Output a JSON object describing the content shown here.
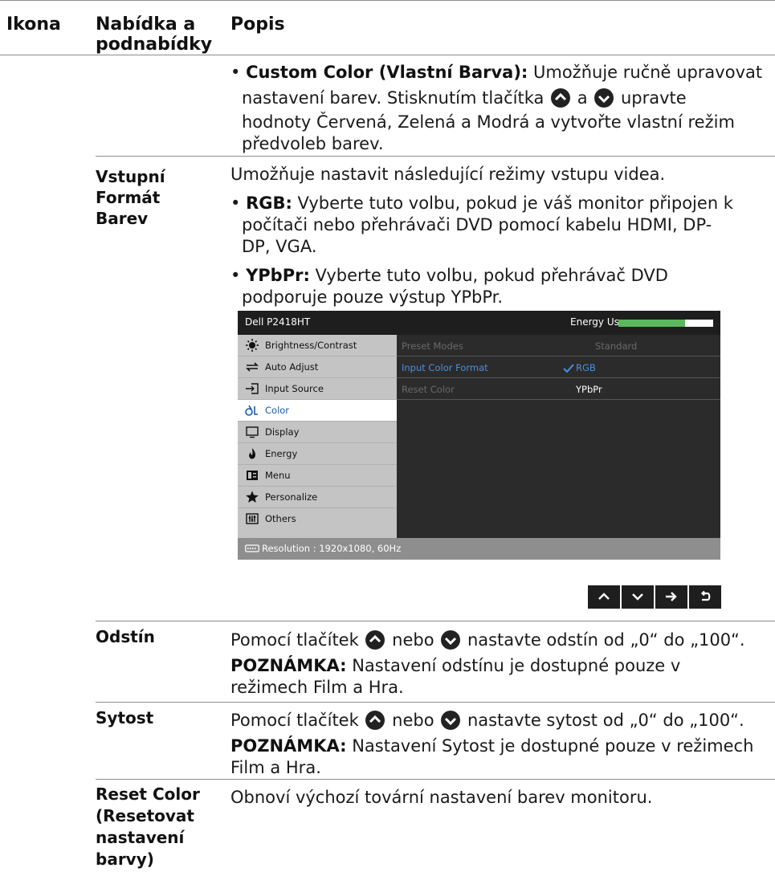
{
  "header": {
    "col1": "Ikona",
    "col2_line1": "Nabídka a",
    "col2_line2": "podnabídky",
    "col3": "Popis"
  },
  "custom_color": {
    "label": "Custom Color (Vlastní Barva):",
    "line1_rest": " Umožňuje ručně upravovat",
    "line2_a": "nastavení barev. Stisknutím tlačítka",
    "line2_b": "a",
    "line2_c": "upravte",
    "line3": "hodnoty Červená, Zelená a Modrá a vytvořte vlastní režim",
    "line4": "předvoleb barev."
  },
  "vstupni": {
    "menu_line1": "Vstupní",
    "menu_line2": "Formát",
    "menu_line3": "Barev",
    "intro": "Umožňuje nastavit následující režimy vstupu videa.",
    "rgb_label": "RGB:",
    "rgb_line1_rest": " Vyberte tuto volbu, pokud je váš monitor připojen k",
    "rgb_line2": "počítači nebo přehrávači DVD pomocí kabelu HDMI, DP-",
    "rgb_line3": "DP, VGA.",
    "ypbpr_label": "YPbPr:",
    "ypbpr_line1_rest": " Vyberte tuto volbu, pokud přehrávač DVD",
    "ypbpr_line2": "podporuje pouze výstup YPbPr."
  },
  "osd": {
    "title": "Dell  P2418HT",
    "energy_label": "Energy Use",
    "energy_level": 0.7,
    "menu": [
      {
        "label": "Brightness/Contrast",
        "icon": "brightness-icon"
      },
      {
        "label": "Auto Adjust",
        "icon": "auto-adjust-icon"
      },
      {
        "label": "Input Source",
        "icon": "input-source-icon"
      },
      {
        "label": "Color",
        "icon": "color-icon",
        "active": true
      },
      {
        "label": "Display",
        "icon": "display-icon"
      },
      {
        "label": "Energy",
        "icon": "energy-icon"
      },
      {
        "label": "Menu",
        "icon": "menu-icon"
      },
      {
        "label": "Personalize",
        "icon": "star-icon"
      },
      {
        "label": "Others",
        "icon": "others-icon"
      }
    ],
    "rows": [
      {
        "label": "Preset Modes",
        "value": "Standard"
      },
      {
        "label": "Input Color Format",
        "value": "RGB"
      },
      {
        "label": "Reset Color",
        "value": "YPbPr"
      }
    ],
    "resolution": "Resolution : 1920x1080, 60Hz",
    "colors": {
      "accent_blue": "#1b5aa6",
      "energy_green": "#5cb85c"
    }
  },
  "odstin": {
    "menu": "Odstín",
    "l1_a": "Pomocí tlačítek",
    "l1_b": "nebo",
    "l1_c": "nastavte odstín od „0“ do „100“.",
    "note_label": "POZNÁMKA:",
    "note_rest": " Nastavení odstínu je dostupné pouze v",
    "note_line2": "režimech Film a Hra."
  },
  "sytost": {
    "menu": "Sytost",
    "l1_a": "Pomocí tlačítek",
    "l1_b": "nebo",
    "l1_c": "nastavte sytost od „0“ do „100“.",
    "note_label": "POZNÁMKA:",
    "note_rest": " Nastavení Sytost je dostupné pouze v režimech",
    "note_line2": "Film a Hra."
  },
  "reset": {
    "menu_line1": "Reset Color",
    "menu_line2": "(Resetovat",
    "menu_line3": "nastavení",
    "menu_line4": "barvy)",
    "desc": "Obnoví výchozí tovární nastavení barev monitoru."
  }
}
